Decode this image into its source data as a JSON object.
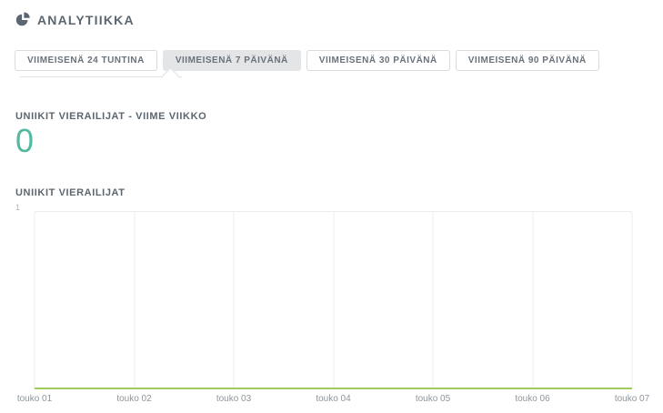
{
  "header": {
    "app_title": "ANALYTIIKKA",
    "logo_icon": "pie-chart-icon"
  },
  "tabs": {
    "items": [
      {
        "label": "VIIMEISENÄ 24 TUNTINA",
        "selected": false
      },
      {
        "label": "VIIMEISENÄ 7 PÄIVÄNÄ",
        "selected": true
      },
      {
        "label": "VIIMEISENÄ 30 PÄIVÄNÄ",
        "selected": false
      },
      {
        "label": "VIIMEISENÄ 90 PÄIVÄNÄ",
        "selected": false
      }
    ]
  },
  "stat": {
    "label": "UNIIKIT VIERAILIJAT - VIIME VIIKKO",
    "value": "0",
    "value_color": "#52b9a0"
  },
  "chart_data": {
    "type": "line",
    "title": "UNIIKIT VIERAILIJAT",
    "x": [
      "touko 01",
      "touko 02",
      "touko 03",
      "touko 04",
      "touko 05",
      "touko 06",
      "touko 07"
    ],
    "series": [
      {
        "name": "uniikit vierailijat",
        "values": [
          0,
          0,
          0,
          0,
          0,
          0,
          0
        ]
      }
    ],
    "ylim": [
      0,
      1
    ],
    "y_tick_labels": [
      "1"
    ],
    "grid": "vertical",
    "legend": "none",
    "line_color": "#a0cc5e"
  },
  "colors": {
    "accent_teal": "#52b9a0",
    "line_green": "#a0cc5e",
    "text_slate": "#5c6670",
    "tab_selected_bg": "#e3e5e7",
    "tab_border": "#d9dbdd",
    "gridline": "#ededee"
  }
}
